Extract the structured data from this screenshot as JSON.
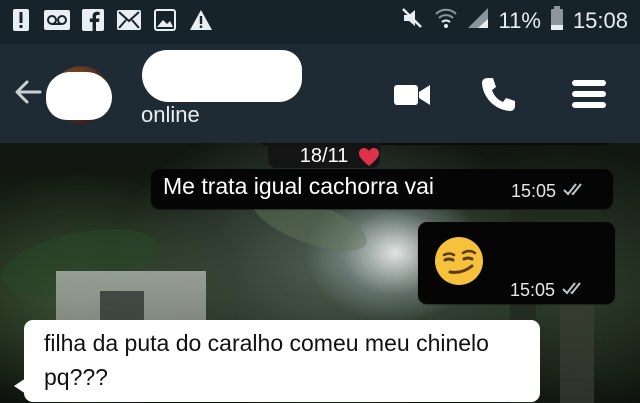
{
  "status_bar": {
    "battery": "11%",
    "time": "15:08",
    "icons": [
      "alert-icon",
      "voicemail-icon",
      "facebook-icon",
      "mail-icon",
      "image-icon",
      "warning-icon",
      "mute-icon",
      "wifi-icon",
      "signal-icon",
      "battery-icon"
    ]
  },
  "header": {
    "status": "online",
    "actions": [
      "video-call-icon",
      "phone-icon",
      "menu-icon"
    ]
  },
  "chat": {
    "date_label": "18/11",
    "messages": [
      {
        "direction": "out",
        "text": "Me trata igual cachorra vai",
        "time": "15:05",
        "ticks": "double"
      },
      {
        "direction": "out",
        "emoji": "smirking-face",
        "time": "15:05",
        "ticks": "double"
      },
      {
        "direction": "in",
        "text": "filha da puta do caralho comeu meu chinelo pq???"
      }
    ]
  },
  "colors": {
    "status_bar_bg": "#17232b",
    "app_bar_bg": "#1e2b34",
    "outgoing_bubble": "#050505",
    "incoming_bubble": "#ffffff"
  }
}
